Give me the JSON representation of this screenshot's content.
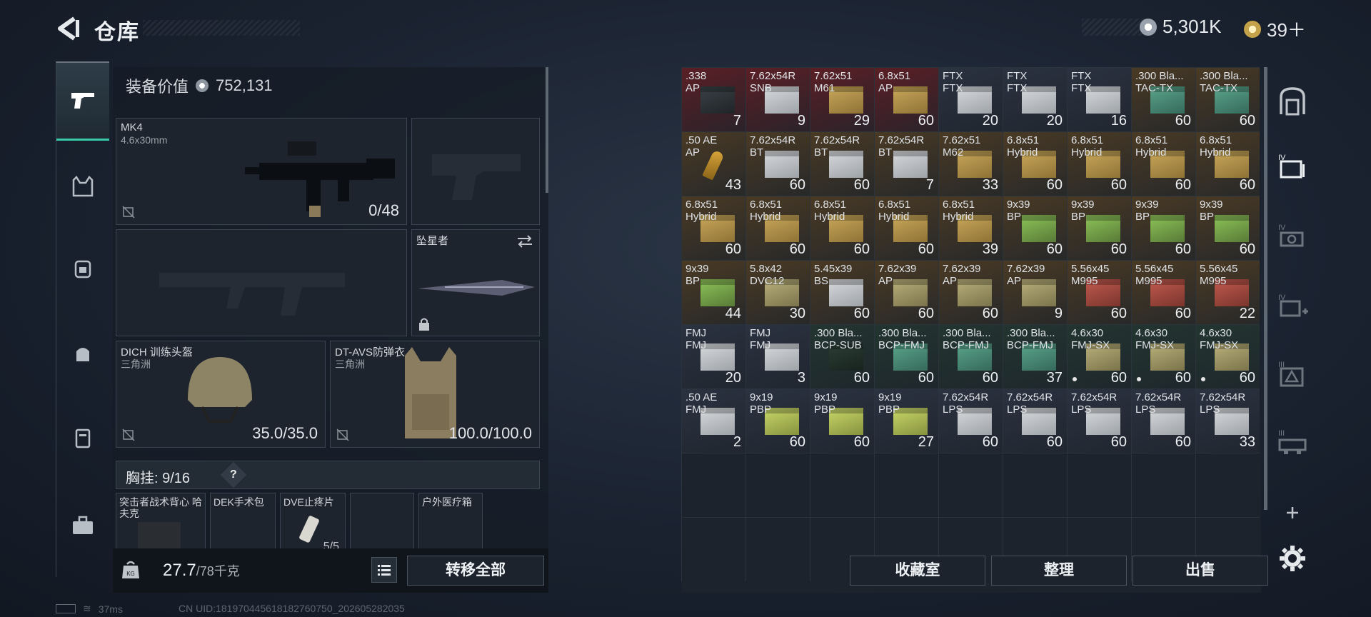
{
  "header": {
    "title": "仓库",
    "money": "5,301K",
    "tickets": "39＋"
  },
  "equipment": {
    "value_label": "装备价值",
    "value": "752,131",
    "primary": {
      "name": "MK4",
      "caliber": "4.6x30mm",
      "ammo": "0/48"
    },
    "melee": {
      "name": "坠星者"
    },
    "helmet": {
      "name": "DICH 训练头盔",
      "sub": "三角洲",
      "durability": "35.0/35.0"
    },
    "armor": {
      "name": "DT-AVS防弹衣",
      "sub": "三角洲",
      "durability": "100.0/100.0"
    },
    "chest_rig": {
      "label": "胸挂:",
      "capacity": "9/16",
      "help": "?"
    },
    "chest_slots": [
      {
        "name": "突击者战术背心 哈夫克"
      },
      {
        "name": "DEK手术包"
      },
      {
        "name": "DVE止疼片",
        "count": "5/5"
      },
      {
        "name": ""
      },
      {
        "name": "户外医疗箱"
      }
    ],
    "weight": "27.7",
    "weight_max": "/78千克",
    "transfer_all": "转移全部"
  },
  "footer": {
    "ping": "37ms",
    "uid": "CN UID:18197044561818276075​0_202605282035"
  },
  "inventory": {
    "rows": [
      [
        {
          "a": ".338",
          "b": "AP",
          "q": "7",
          "c": "#5a1f25",
          "t": "mag"
        },
        {
          "a": "7.62x54R",
          "b": "SNB",
          "q": "9",
          "c": "#5a1f25",
          "t": "white"
        },
        {
          "a": "7.62x51",
          "b": "M61",
          "q": "29",
          "c": "#5a1f25",
          "t": "gold"
        },
        {
          "a": "6.8x51",
          "b": "AP",
          "q": "60",
          "c": "#5a1f25",
          "t": "gold"
        },
        {
          "a": "FTX",
          "b": "FTX",
          "q": "20",
          "c": "#2b3240",
          "t": "white"
        },
        {
          "a": "FTX",
          "b": "FTX",
          "q": "20",
          "c": "#2b3240",
          "t": "white"
        },
        {
          "a": "FTX",
          "b": "FTX",
          "q": "16",
          "c": "#2b3240",
          "t": "white"
        },
        {
          "a": ".300 Bla...",
          "b": "TAC-TX",
          "q": "60",
          "c": "#4a3a24",
          "t": "teal"
        },
        {
          "a": ".300 Bla...",
          "b": "TAC-TX",
          "q": "60",
          "c": "#4a3a24",
          "t": "teal"
        }
      ],
      [
        {
          "a": ".50 AE",
          "b": "AP",
          "q": "43",
          "c": "#4a3a24",
          "t": "bullet"
        },
        {
          "a": "7.62x54R",
          "b": "BT",
          "q": "60",
          "c": "#4a3a24",
          "t": "white"
        },
        {
          "a": "7.62x54R",
          "b": "BT",
          "q": "60",
          "c": "#4a3a24",
          "t": "white"
        },
        {
          "a": "7.62x54R",
          "b": "BT",
          "q": "7",
          "c": "#4a3a24",
          "t": "white"
        },
        {
          "a": "7.62x51",
          "b": "M62",
          "q": "33",
          "c": "#4a3a24",
          "t": "gold"
        },
        {
          "a": "6.8x51",
          "b": "Hybrid",
          "q": "60",
          "c": "#4a3a24",
          "t": "gold"
        },
        {
          "a": "6.8x51",
          "b": "Hybrid",
          "q": "60",
          "c": "#4a3a24",
          "t": "gold"
        },
        {
          "a": "6.8x51",
          "b": "Hybrid",
          "q": "60",
          "c": "#4a3a24",
          "t": "gold"
        },
        {
          "a": "6.8x51",
          "b": "Hybrid",
          "q": "60",
          "c": "#4a3a24",
          "t": "gold"
        }
      ],
      [
        {
          "a": "6.8x51",
          "b": "Hybrid",
          "q": "60",
          "c": "#4a3a24",
          "t": "gold"
        },
        {
          "a": "6.8x51",
          "b": "Hybrid",
          "q": "60",
          "c": "#4a3a24",
          "t": "gold"
        },
        {
          "a": "6.8x51",
          "b": "Hybrid",
          "q": "60",
          "c": "#4a3a24",
          "t": "gold"
        },
        {
          "a": "6.8x51",
          "b": "Hybrid",
          "q": "60",
          "c": "#4a3a24",
          "t": "gold"
        },
        {
          "a": "6.8x51",
          "b": "Hybrid",
          "q": "39",
          "c": "#4a3a24",
          "t": "gold"
        },
        {
          "a": "9x39",
          "b": "BP",
          "q": "60",
          "c": "#4a3a24",
          "t": "green"
        },
        {
          "a": "9x39",
          "b": "BP",
          "q": "60",
          "c": "#4a3a24",
          "t": "green"
        },
        {
          "a": "9x39",
          "b": "BP",
          "q": "60",
          "c": "#4a3a24",
          "t": "green"
        },
        {
          "a": "9x39",
          "b": "BP",
          "q": "60",
          "c": "#4a3a24",
          "t": "green"
        }
      ],
      [
        {
          "a": "9x39",
          "b": "BP",
          "q": "44",
          "c": "#4a3a24",
          "t": "green"
        },
        {
          "a": "5.8x42",
          "b": "DVC12",
          "q": "30",
          "c": "#4a3a24",
          "t": "olive"
        },
        {
          "a": "5.45x39",
          "b": "BS",
          "q": "60",
          "c": "#4a3a24",
          "t": "white"
        },
        {
          "a": "7.62x39",
          "b": "AP",
          "q": "60",
          "c": "#4a3a24",
          "t": "olive"
        },
        {
          "a": "7.62x39",
          "b": "AP",
          "q": "60",
          "c": "#4a3a24",
          "t": "olive"
        },
        {
          "a": "7.62x39",
          "b": "AP",
          "q": "9",
          "c": "#4a3a24",
          "t": "olive"
        },
        {
          "a": "5.56x45",
          "b": "M995",
          "q": "60",
          "c": "#4a3a24",
          "t": "red"
        },
        {
          "a": "5.56x45",
          "b": "M995",
          "q": "60",
          "c": "#4a3a24",
          "t": "red"
        },
        {
          "a": "5.56x45",
          "b": "M995",
          "q": "22",
          "c": "#4a3a24",
          "t": "red"
        }
      ],
      [
        {
          "a": "FMJ",
          "b": "FMJ",
          "q": "20",
          "c": "#2b3240",
          "t": "white"
        },
        {
          "a": "FMJ",
          "b": "FMJ",
          "q": "3",
          "c": "#2b3240",
          "t": "white"
        },
        {
          "a": ".300 Bla...",
          "b": "BCP-SUB",
          "q": "60",
          "c": "#233530",
          "t": "mag2"
        },
        {
          "a": ".300 Bla...",
          "b": "BCP-FMJ",
          "q": "60",
          "c": "#233530",
          "t": "teal"
        },
        {
          "a": ".300 Bla...",
          "b": "BCP-FMJ",
          "q": "60",
          "c": "#233530",
          "t": "teal"
        },
        {
          "a": ".300 Bla...",
          "b": "BCP-FMJ",
          "q": "37",
          "c": "#233530",
          "t": "teal"
        },
        {
          "a": "4.6x30",
          "b": "FMJ-SX",
          "q": "60",
          "c": "#233530",
          "t": "olive",
          "dot": true
        },
        {
          "a": "4.6x30",
          "b": "FMJ-SX",
          "q": "60",
          "c": "#233530",
          "t": "olive",
          "dot": true
        },
        {
          "a": "4.6x30",
          "b": "FMJ-SX",
          "q": "60",
          "c": "#233530",
          "t": "olive",
          "dot": true
        }
      ],
      [
        {
          "a": ".50 AE",
          "b": "FMJ",
          "q": "2",
          "c": "#2b3240",
          "t": "white"
        },
        {
          "a": "9x19",
          "b": "PBP",
          "q": "60",
          "c": "#2b3240",
          "t": "lime"
        },
        {
          "a": "9x19",
          "b": "PBP",
          "q": "60",
          "c": "#2b3240",
          "t": "lime"
        },
        {
          "a": "9x19",
          "b": "PBP",
          "q": "27",
          "c": "#2b3240",
          "t": "lime"
        },
        {
          "a": "7.62x54R",
          "b": "LPS",
          "q": "60",
          "c": "#2b3240",
          "t": "white"
        },
        {
          "a": "7.62x54R",
          "b": "LPS",
          "q": "60",
          "c": "#2b3240",
          "t": "white"
        },
        {
          "a": "7.62x54R",
          "b": "LPS",
          "q": "60",
          "c": "#2b3240",
          "t": "white"
        },
        {
          "a": "7.62x54R",
          "b": "LPS",
          "q": "60",
          "c": "#2b3240",
          "t": "white"
        },
        {
          "a": "7.62x54R",
          "b": "LPS",
          "q": "33",
          "c": "#2b3240",
          "t": "white"
        }
      ]
    ],
    "buttons": {
      "collection": "收藏室",
      "sort": "整理",
      "sell": "出售"
    }
  },
  "colors": {
    "accent": "#38c9a8",
    "panel": "#1c232c"
  }
}
